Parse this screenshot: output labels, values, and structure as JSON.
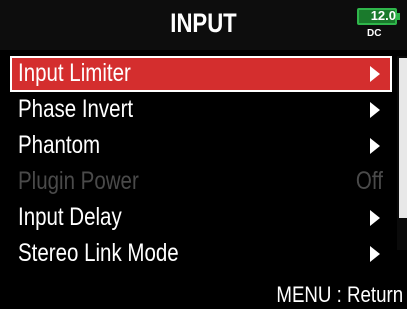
{
  "header": {
    "title": "INPUT",
    "battery": {
      "value": "12.0",
      "source": "DC",
      "color": "#2fb64b"
    }
  },
  "menu": {
    "items": [
      {
        "label": "Input Limiter",
        "selected": true,
        "enabled": true,
        "indicator": "arrow"
      },
      {
        "label": "Phase Invert",
        "selected": false,
        "enabled": true,
        "indicator": "arrow"
      },
      {
        "label": "Phantom",
        "selected": false,
        "enabled": true,
        "indicator": "arrow"
      },
      {
        "label": "Plugin Power",
        "selected": false,
        "enabled": false,
        "value": "Off"
      },
      {
        "label": "Input Delay",
        "selected": false,
        "enabled": true,
        "indicator": "arrow"
      },
      {
        "label": "Stereo Link Mode",
        "selected": false,
        "enabled": true,
        "indicator": "arrow"
      }
    ],
    "selected_color": "#d42e2e"
  },
  "footer": {
    "hint": "MENU : Return"
  }
}
